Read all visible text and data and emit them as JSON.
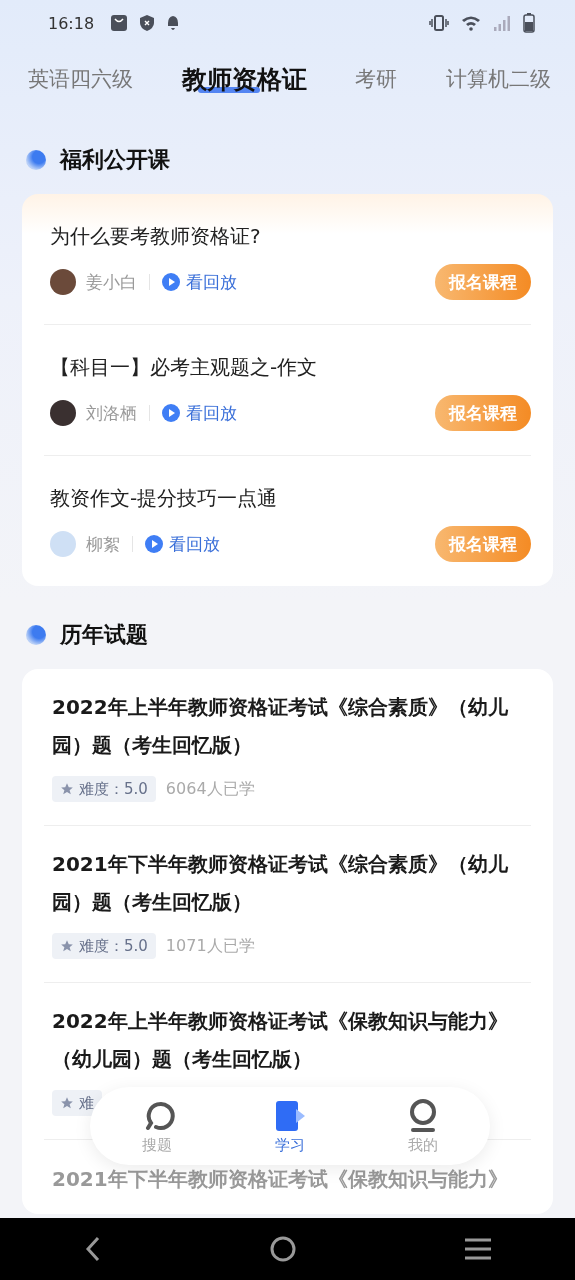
{
  "status_bar": {
    "time": "16:18"
  },
  "tabs": [
    {
      "label": "英语四六级",
      "selected": false
    },
    {
      "label": "教师资格证",
      "selected": true
    },
    {
      "label": "考研",
      "selected": false
    },
    {
      "label": "计算机二级",
      "selected": false
    }
  ],
  "open_courses": {
    "title": "福利公开课",
    "items": [
      {
        "title": "为什么要考教师资格证?",
        "teacher": "姜小白",
        "replay": "看回放",
        "button": "报名课程"
      },
      {
        "title": "【科目一】必考主观题之-作文",
        "teacher": "刘洛栖",
        "replay": "看回放",
        "button": "报名课程"
      },
      {
        "title": "教资作文-提分技巧一点通",
        "teacher": "柳絮",
        "replay": "看回放",
        "button": "报名课程"
      }
    ]
  },
  "past_exams": {
    "title": "历年试题",
    "items": [
      {
        "title": "2022年上半年教师资格证考试《综合素质》（幼儿园）题（考生回忆版）",
        "difficulty": "难度：5.0",
        "learners": "6064人已学"
      },
      {
        "title": "2021年下半年教师资格证考试《综合素质》（幼儿园）题（考生回忆版）",
        "difficulty": "难度：5.0",
        "learners": "1071人已学"
      },
      {
        "title": "2022年上半年教师资格证考试《保教知识与能力》（幼儿园）题（考生回忆版）",
        "difficulty": "难"
      },
      {
        "title": "2021年下半年教师资格证考试《保教知识与能力》"
      }
    ]
  },
  "bottom_nav": [
    {
      "label": "搜题",
      "selected": false
    },
    {
      "label": "学习",
      "selected": true
    },
    {
      "label": "我的",
      "selected": false
    }
  ]
}
